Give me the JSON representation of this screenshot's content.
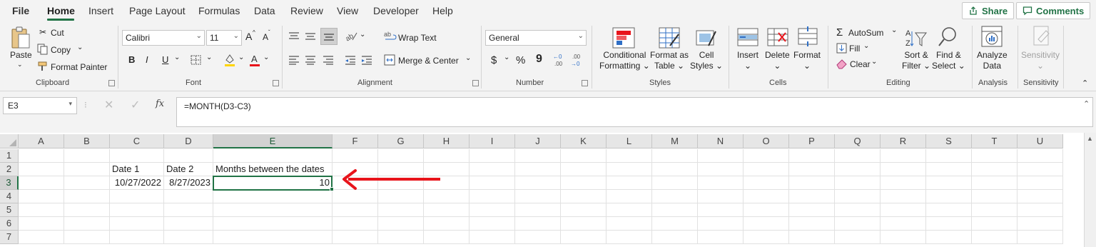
{
  "tabs": [
    "File",
    "Home",
    "Insert",
    "Page Layout",
    "Formulas",
    "Data",
    "Review",
    "View",
    "Developer",
    "Help"
  ],
  "active_tab": "Home",
  "share_label": "Share",
  "comments_label": "Comments",
  "clipboard": {
    "paste": "Paste",
    "cut": "Cut",
    "copy": "Copy",
    "format_painter": "Format Painter",
    "label": "Clipboard"
  },
  "font": {
    "name": "Calibri",
    "size": "11",
    "bold": "B",
    "italic": "I",
    "underline": "U",
    "grow": "A",
    "shrink": "A",
    "label": "Font"
  },
  "alignment": {
    "wrap_text": "Wrap Text",
    "merge_center": "Merge & Center",
    "label": "Alignment"
  },
  "number": {
    "format": "General",
    "currency": "$",
    "percent": "%",
    "comma": "9",
    "label": "Number"
  },
  "styles": {
    "conditional_1": "Conditional",
    "conditional_2": "Formatting",
    "format_table_1": "Format as",
    "format_table_2": "Table",
    "cell_styles_1": "Cell",
    "cell_styles_2": "Styles",
    "label": "Styles"
  },
  "cells": {
    "insert": "Insert",
    "delete": "Delete",
    "format": "Format",
    "label": "Cells"
  },
  "editing": {
    "autosum": "AutoSum",
    "fill": "Fill",
    "clear": "Clear",
    "sort_1": "Sort &",
    "sort_2": "Filter",
    "find_1": "Find &",
    "find_2": "Select",
    "label": "Editing"
  },
  "analysis": {
    "analyze_1": "Analyze",
    "analyze_2": "Data",
    "label": "Analysis"
  },
  "sensitivity": {
    "button": "Sensitivity",
    "label": "Sensitivity"
  },
  "name_box": "E3",
  "fx": "fx",
  "formula": "=MONTH(D3-C3)",
  "columns": [
    "A",
    "B",
    "C",
    "D",
    "E",
    "F",
    "G",
    "H",
    "I",
    "J",
    "K",
    "L",
    "M",
    "N",
    "O",
    "P",
    "Q",
    "R",
    "S",
    "T",
    "U"
  ],
  "rows": [
    "1",
    "2",
    "3",
    "4",
    "5",
    "6",
    "7"
  ],
  "cell_values": {
    "C2": "Date 1",
    "D2": "Date 2",
    "E2": "Months between the dates",
    "C3": "10/27/2022",
    "D3": "8/27/2023",
    "E3": "10"
  },
  "colors": {
    "accent": "#217346",
    "arrow": "#e8141b"
  }
}
